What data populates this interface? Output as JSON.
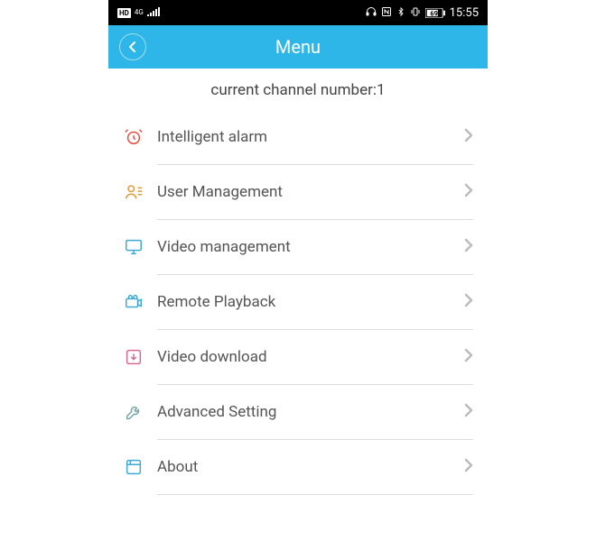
{
  "status_bar": {
    "hd_label": "HD",
    "signal_label": "4G",
    "battery_label": "69",
    "time": "15:55"
  },
  "header": {
    "title": "Menu"
  },
  "subtitle": "current channel number:1",
  "menu": {
    "items": [
      {
        "id": "intelligent-alarm",
        "label": "Intelligent alarm",
        "icon": "alarm-clock-icon",
        "color": "#e74c3c"
      },
      {
        "id": "user-management",
        "label": "User Management",
        "icon": "users-icon",
        "color": "#e09a3e"
      },
      {
        "id": "video-management",
        "label": "Video management",
        "icon": "monitor-icon",
        "color": "#3da9d4"
      },
      {
        "id": "remote-playback",
        "label": "Remote Playback",
        "icon": "camera-icon",
        "color": "#3da9d4"
      },
      {
        "id": "video-download",
        "label": "Video download",
        "icon": "download-icon",
        "color": "#d46b8f"
      },
      {
        "id": "advanced-setting",
        "label": "Advanced Setting",
        "icon": "wrench-icon",
        "color": "#7aa6a6"
      },
      {
        "id": "about",
        "label": "About",
        "icon": "browser-icon",
        "color": "#3da9d4"
      }
    ]
  }
}
